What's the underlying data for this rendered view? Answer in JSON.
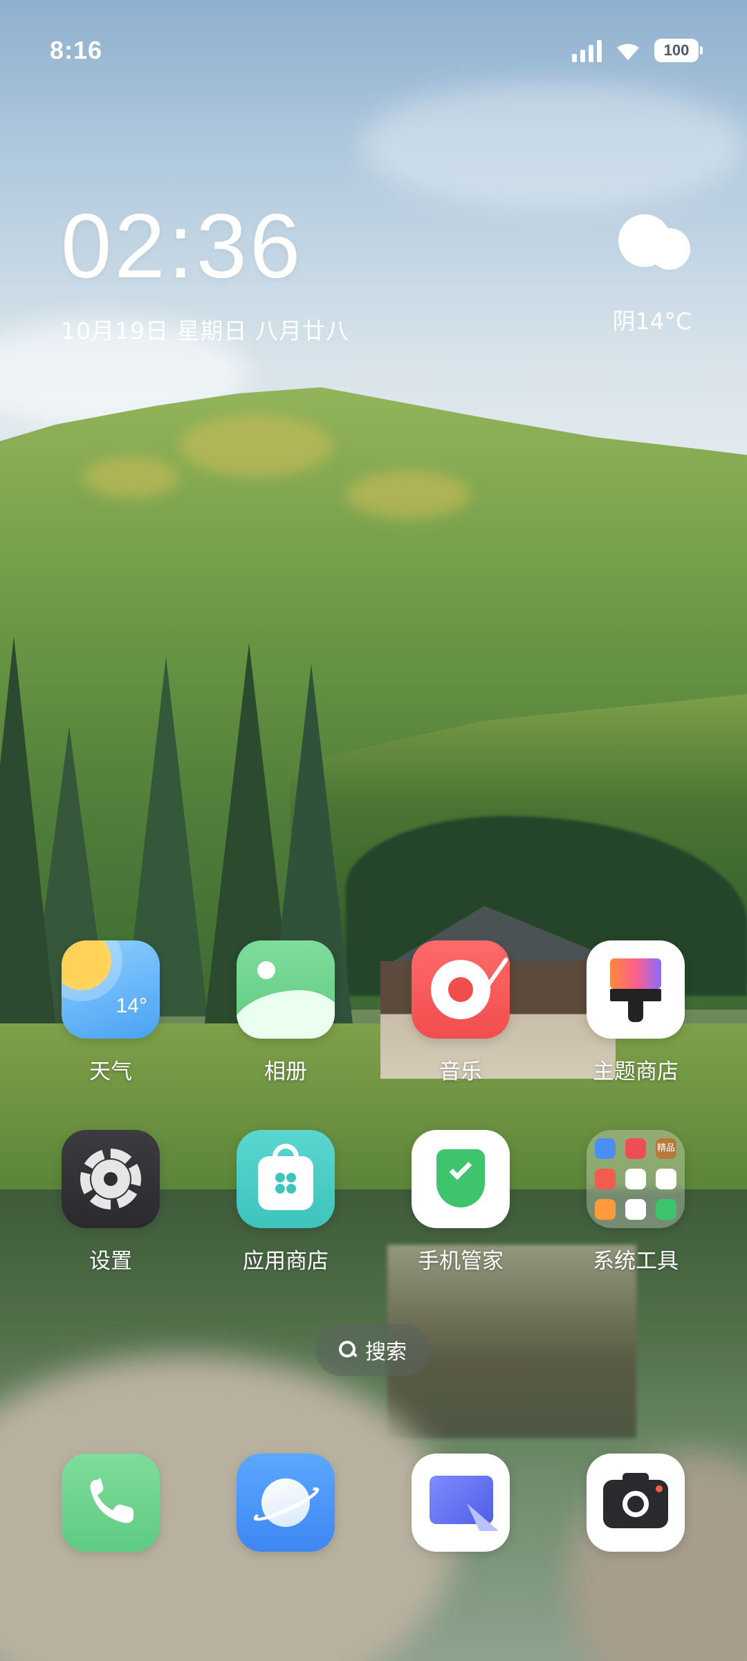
{
  "status_bar": {
    "time": "8:16",
    "battery": "100",
    "icons": [
      "signal-icon",
      "wifi-icon",
      "battery-icon"
    ]
  },
  "clock_widget": {
    "time": "02:36",
    "date": "10月19日 星期日 八月廿八"
  },
  "weather_widget": {
    "icon": "cloudy-icon",
    "text": "阴14°C"
  },
  "apps_row1": [
    {
      "label": "天气",
      "icon": "weather-icon",
      "badge_text": "14°"
    },
    {
      "label": "相册",
      "icon": "gallery-icon"
    },
    {
      "label": "音乐",
      "icon": "music-icon"
    },
    {
      "label": "主题商店",
      "icon": "theme-store-icon"
    }
  ],
  "apps_row2": [
    {
      "label": "设置",
      "icon": "settings-icon"
    },
    {
      "label": "应用商店",
      "icon": "app-store-icon"
    },
    {
      "label": "手机管家",
      "icon": "security-icon"
    },
    {
      "label": "系统工具",
      "icon": "folder-icon"
    }
  ],
  "folder_mini_labels": [
    "精品"
  ],
  "search": {
    "label": "搜索",
    "icon": "search-icon"
  },
  "dock": [
    {
      "icon": "phone-icon"
    },
    {
      "icon": "browser-icon"
    },
    {
      "icon": "notes-icon"
    },
    {
      "icon": "camera-icon"
    }
  ],
  "colors": {
    "sky": "#b6cde0",
    "grass": "#6e9a46",
    "lake": "#52704a",
    "music_red": "#f24d4d",
    "security_green": "#3ec46d"
  }
}
